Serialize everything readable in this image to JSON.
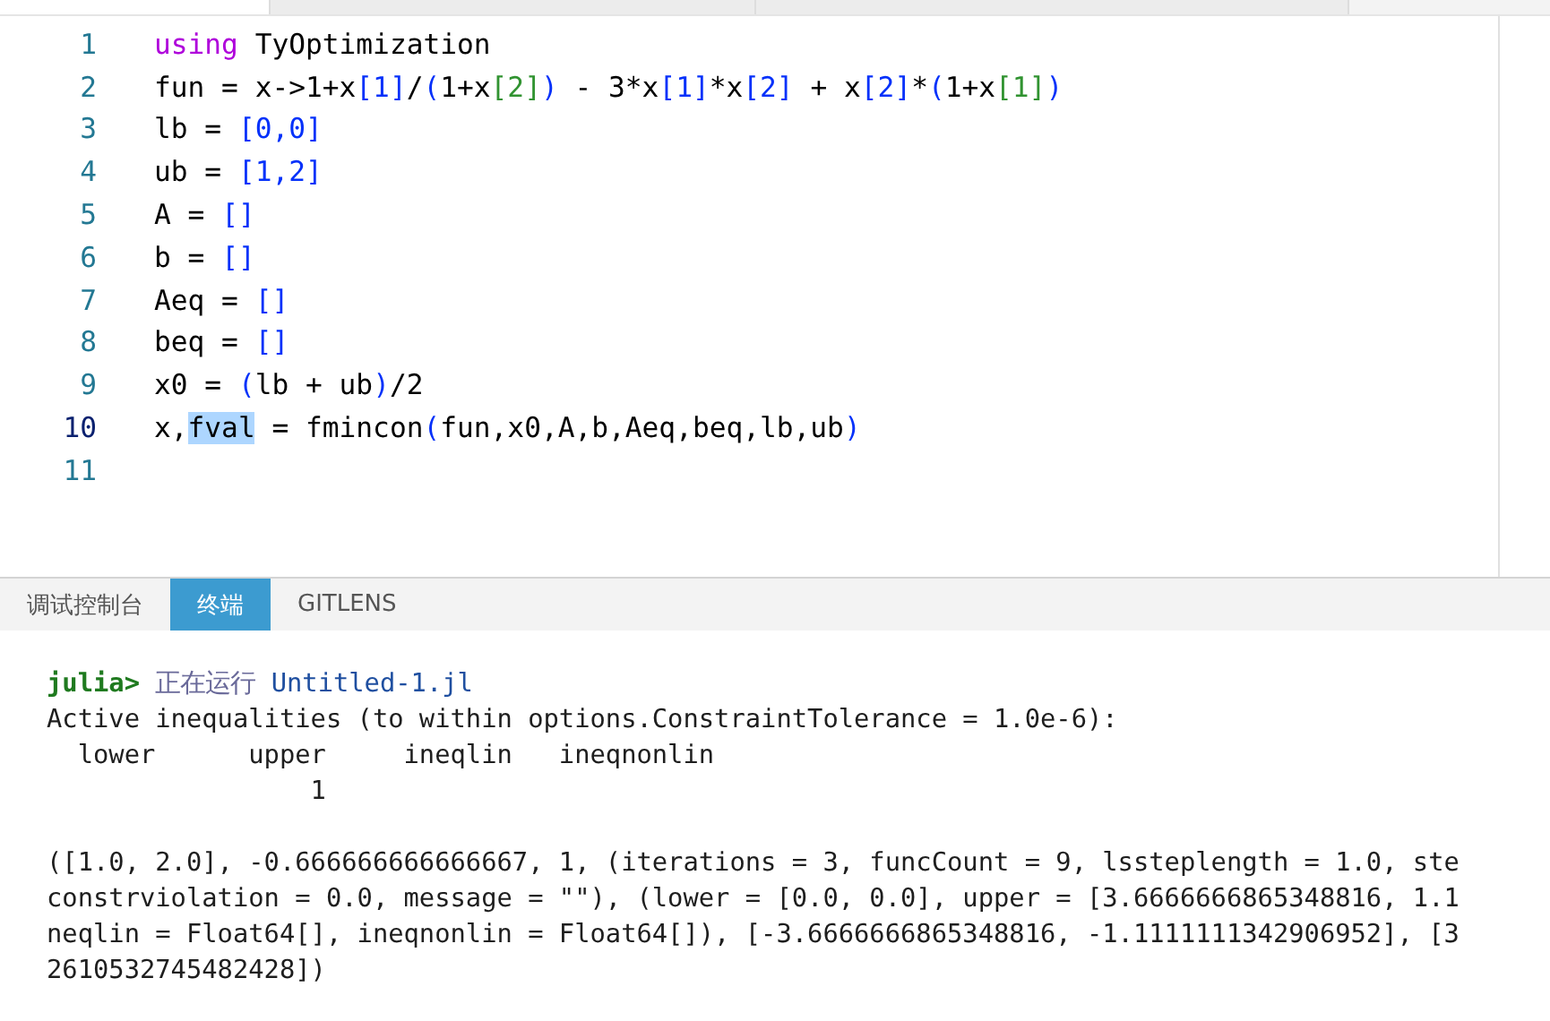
{
  "editor": {
    "lines": [
      {
        "number": "1",
        "current": false,
        "tokens": [
          {
            "kind": "keyword",
            "text": "using"
          },
          {
            "kind": "text",
            "text": " TyOptimization"
          }
        ]
      },
      {
        "number": "2",
        "current": false,
        "tokens": [
          {
            "kind": "text",
            "text": "fun = x->1+x"
          },
          {
            "kind": "bracket1",
            "text": "[1]"
          },
          {
            "kind": "text",
            "text": "/"
          },
          {
            "kind": "bracket1",
            "text": "("
          },
          {
            "kind": "text",
            "text": "1+x"
          },
          {
            "kind": "bracket2",
            "text": "[2]"
          },
          {
            "kind": "bracket1",
            "text": ")"
          },
          {
            "kind": "text",
            "text": " - 3*x"
          },
          {
            "kind": "bracket1",
            "text": "[1]"
          },
          {
            "kind": "text",
            "text": "*x"
          },
          {
            "kind": "bracket1",
            "text": "[2]"
          },
          {
            "kind": "text",
            "text": " + x"
          },
          {
            "kind": "bracket1",
            "text": "[2]"
          },
          {
            "kind": "text",
            "text": "*"
          },
          {
            "kind": "bracket1",
            "text": "("
          },
          {
            "kind": "text",
            "text": "1+x"
          },
          {
            "kind": "bracket2",
            "text": "[1]"
          },
          {
            "kind": "bracket1",
            "text": ")"
          }
        ]
      },
      {
        "number": "3",
        "current": false,
        "tokens": [
          {
            "kind": "text",
            "text": "lb = "
          },
          {
            "kind": "bracket1",
            "text": "[0,0]"
          }
        ]
      },
      {
        "number": "4",
        "current": false,
        "tokens": [
          {
            "kind": "text",
            "text": "ub = "
          },
          {
            "kind": "bracket1",
            "text": "[1,2]"
          }
        ]
      },
      {
        "number": "5",
        "current": false,
        "tokens": [
          {
            "kind": "text",
            "text": "A = "
          },
          {
            "kind": "bracket1",
            "text": "[]"
          }
        ]
      },
      {
        "number": "6",
        "current": false,
        "tokens": [
          {
            "kind": "text",
            "text": "b = "
          },
          {
            "kind": "bracket1",
            "text": "[]"
          }
        ]
      },
      {
        "number": "7",
        "current": false,
        "tokens": [
          {
            "kind": "text",
            "text": "Aeq = "
          },
          {
            "kind": "bracket1",
            "text": "[]"
          }
        ]
      },
      {
        "number": "8",
        "current": false,
        "tokens": [
          {
            "kind": "text",
            "text": "beq = "
          },
          {
            "kind": "bracket1",
            "text": "[]"
          }
        ]
      },
      {
        "number": "9",
        "current": false,
        "tokens": [
          {
            "kind": "text",
            "text": "x0 = "
          },
          {
            "kind": "bracket1",
            "text": "("
          },
          {
            "kind": "text",
            "text": "lb + ub"
          },
          {
            "kind": "bracket1",
            "text": ")"
          },
          {
            "kind": "text",
            "text": "/2"
          }
        ]
      },
      {
        "number": "10",
        "current": true,
        "tokens": [
          {
            "kind": "text",
            "text": "x,"
          },
          {
            "kind": "selection",
            "text": "fval"
          },
          {
            "kind": "text",
            "text": " = fmincon"
          },
          {
            "kind": "bracket1",
            "text": "("
          },
          {
            "kind": "text",
            "text": "fun,x0,A,b,Aeq,beq,lb,ub"
          },
          {
            "kind": "bracket1",
            "text": ")"
          }
        ]
      },
      {
        "number": "11",
        "current": false
      }
    ]
  },
  "panel": {
    "tabs": [
      {
        "label": "调试控制台",
        "selected": false
      },
      {
        "label": "终端",
        "selected": true
      },
      {
        "label": "GITLENS",
        "selected": false
      }
    ],
    "terminal": {
      "prompt": "julia>",
      "status": "正在运行",
      "file": "Untitled-1.jl",
      "output_blocks": [
        [
          "Active inequalities (to within options.ConstraintTolerance = 1.0e-6):",
          "  lower      upper     ineqlin   ineqnonlin",
          "                 1"
        ],
        [
          "([1.0, 2.0], -0.666666666666667, 1, (iterations = 3, funcCount = 9, lssteplength = 1.0, ste",
          "constrviolation = 0.0, message = \"\"), (lower = [0.0, 0.0], upper = [3.6666666865348816, 1.1",
          "neqlin = Float64[], ineqnonlin = Float64[]), [-3.6666666865348816, -1.1111111342906952], [3",
          "2610532745482428])"
        ]
      ]
    }
  }
}
